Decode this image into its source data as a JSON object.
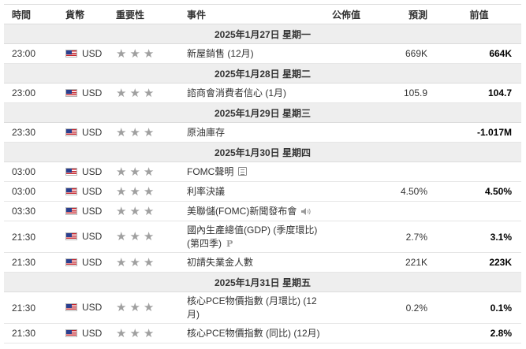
{
  "headers": {
    "time": "時間",
    "currency": "貨幣",
    "importance": "重要性",
    "event": "事件",
    "actual": "公佈值",
    "forecast": "預測",
    "previous": "前值"
  },
  "days": [
    {
      "date": "2025年1月27日 星期一",
      "events": [
        {
          "time": "23:00",
          "currency": "USD",
          "stars": "★★★",
          "name": "新屋銷售 (12月)",
          "actual": "",
          "forecast": "669K",
          "previous": "664K"
        }
      ]
    },
    {
      "date": "2025年1月28日 星期二",
      "events": [
        {
          "time": "23:00",
          "currency": "USD",
          "stars": "★★★",
          "name": "諮商會消費者信心 (1月)",
          "actual": "",
          "forecast": "105.9",
          "previous": "104.7"
        }
      ]
    },
    {
      "date": "2025年1月29日 星期三",
      "events": [
        {
          "time": "23:30",
          "currency": "USD",
          "stars": "★★★",
          "name": "原油庫存",
          "actual": "",
          "forecast": "",
          "previous": "-1.017M"
        }
      ]
    },
    {
      "date": "2025年1月30日 星期四",
      "events": [
        {
          "time": "03:00",
          "currency": "USD",
          "stars": "★★★",
          "name": "FOMC聲明",
          "icon": "document-icon",
          "actual": "",
          "forecast": "",
          "previous": ""
        },
        {
          "time": "03:00",
          "currency": "USD",
          "stars": "★★★",
          "name": "利率決議",
          "actual": "",
          "forecast": "4.50%",
          "previous": "4.50%"
        },
        {
          "time": "03:30",
          "currency": "USD",
          "stars": "★★★",
          "name": "美聯儲(FOMC)新聞發布會",
          "icon": "speaker-icon",
          "actual": "",
          "forecast": "",
          "previous": ""
        },
        {
          "time": "21:30",
          "currency": "USD",
          "stars": "★★★",
          "name": "國內生產總值(GDP) (季度環比) (第四季)",
          "icon": "preliminary-icon",
          "icon_text": "P",
          "actual": "",
          "forecast": "2.7%",
          "previous": "3.1%"
        },
        {
          "time": "21:30",
          "currency": "USD",
          "stars": "★★★",
          "name": "初請失業金人數",
          "actual": "",
          "forecast": "221K",
          "previous": "223K"
        }
      ]
    },
    {
      "date": "2025年1月31日 星期五",
      "events": [
        {
          "time": "21:30",
          "currency": "USD",
          "stars": "★★★",
          "name": "核心PCE物價指數 (月環比) (12月)",
          "actual": "",
          "forecast": "0.2%",
          "previous": "0.1%"
        },
        {
          "time": "21:30",
          "currency": "USD",
          "stars": "★★★",
          "name": "核心PCE物價指數 (同比) (12月)",
          "actual": "",
          "forecast": "",
          "previous": "2.8%"
        }
      ]
    }
  ],
  "colors": {
    "day_header_bg": "#eeeeee",
    "border": "#dcdcdc",
    "star_gray": "#a0a0a0",
    "flag_red": "#c4262e",
    "flag_blue": "#2a3f8f"
  }
}
